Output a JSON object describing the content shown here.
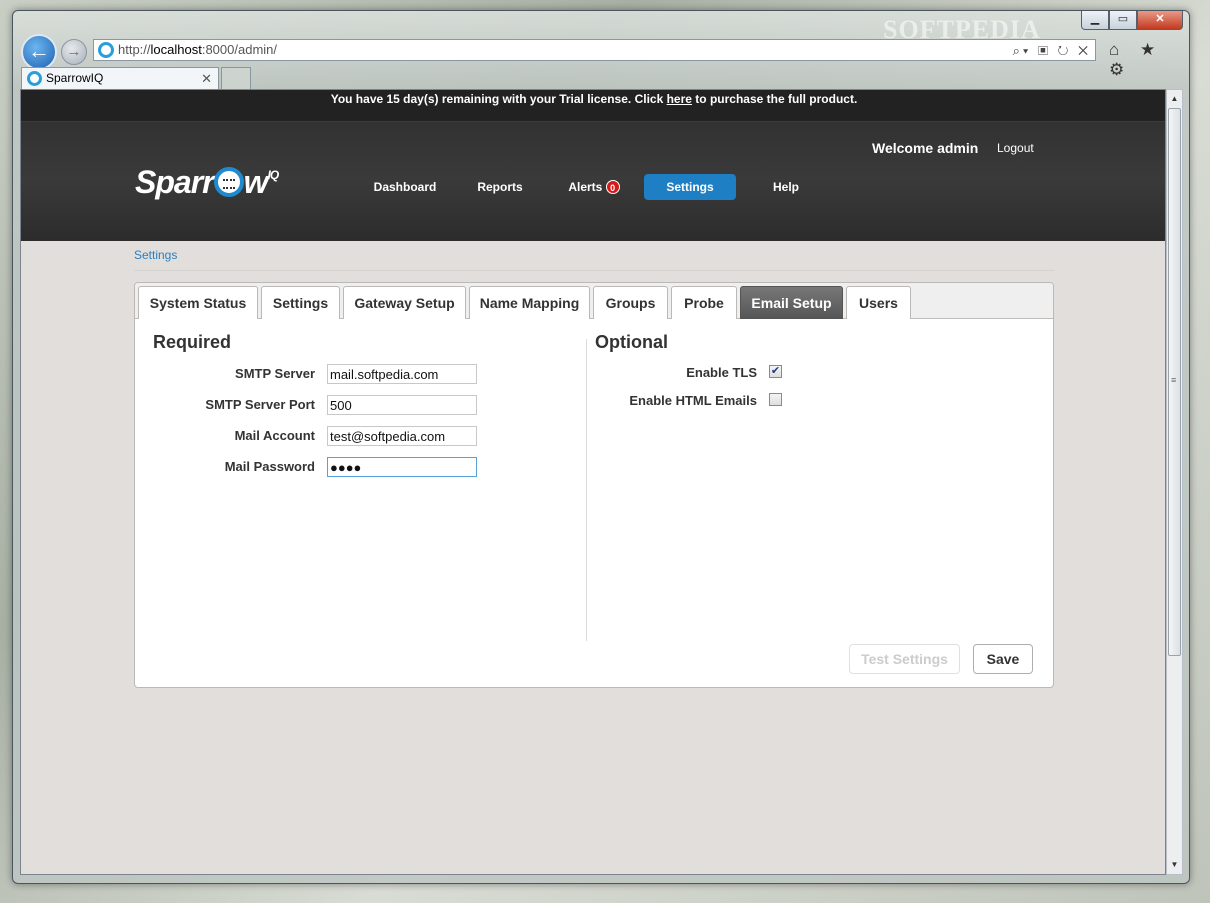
{
  "watermark": "SOFTPEDIA",
  "window_controls": {
    "minimize": "▁",
    "maximize": "▭",
    "close": "✕"
  },
  "browser": {
    "url_prefix": "http://",
    "url_host": "localhost",
    "url_rest": ":8000/admin/",
    "address_tools": "⌕▾ ▣ ↻ ✕",
    "toolbar_icons": "⌂ ★ ⚙",
    "tab_title": "SparrowIQ",
    "tab_close": "✕"
  },
  "site": {
    "trial_before": "You have 15 day(s) remaining with your Trial license. Click ",
    "trial_link": "here",
    "trial_after": " to purchase the full product.",
    "welcome": "Welcome admin",
    "logout": "Logout",
    "logo_pre": "Sparr",
    "logo_post": "w",
    "logo_sup": "IQ",
    "nav": {
      "dashboard": "Dashboard",
      "reports": "Reports",
      "alerts": "Alerts",
      "alerts_count": "0",
      "settings": "Settings",
      "help": "Help"
    }
  },
  "breadcrumb": "Settings",
  "tabs": {
    "system_status": "System Status",
    "settings": "Settings",
    "gateway_setup": "Gateway Setup",
    "name_mapping": "Name Mapping",
    "groups": "Groups",
    "probe": "Probe",
    "email_setup": "Email Setup",
    "users": "Users"
  },
  "required": {
    "title": "Required",
    "smtp_server_label": "SMTP Server",
    "smtp_server_value": "mail.softpedia.com",
    "smtp_port_label": "SMTP Server Port",
    "smtp_port_value": "500",
    "mail_account_label": "Mail Account",
    "mail_account_value": "test@softpedia.com",
    "mail_password_label": "Mail Password",
    "mail_password_value": "●●●●"
  },
  "optional": {
    "title": "Optional",
    "enable_tls_label": "Enable TLS",
    "enable_tls_checked": true,
    "enable_html_label": "Enable HTML Emails",
    "enable_html_checked": false
  },
  "buttons": {
    "test_settings": "Test Settings",
    "save": "Save"
  },
  "colors": {
    "accent": "#1e7fc4",
    "badge": "#d81818",
    "header_bg": "#2e2e2e",
    "page_bg": "#e2dedb"
  }
}
